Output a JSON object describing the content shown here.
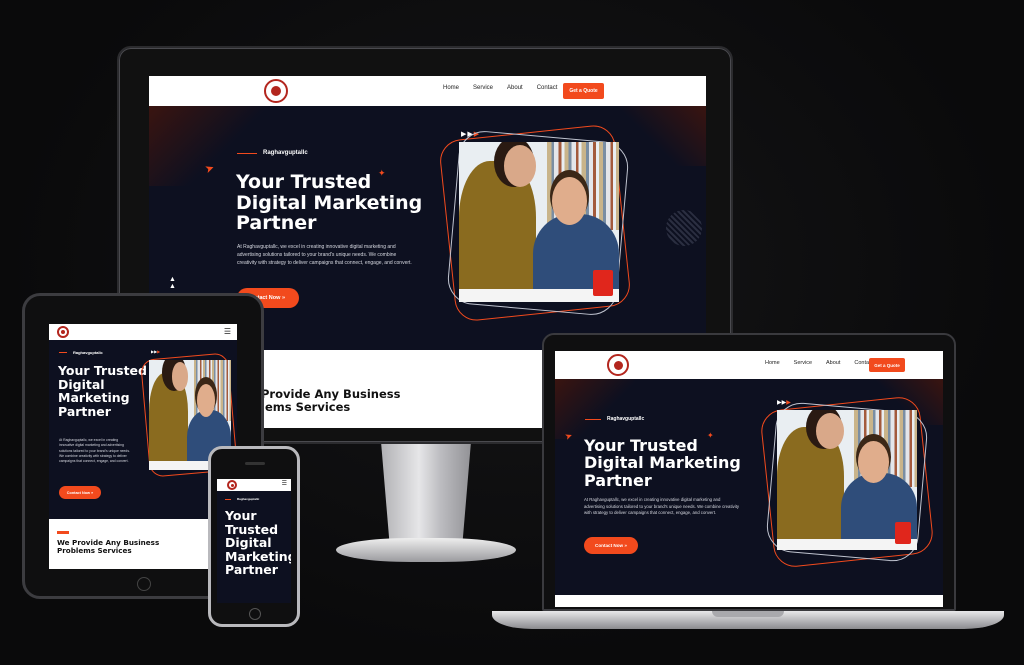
{
  "nav": {
    "items": [
      "Home",
      "Service",
      "About",
      "Contact"
    ],
    "quote_button": "Get a Quote"
  },
  "hero": {
    "eyebrow": "Raghavguptallc",
    "title_line1": "Your Trusted",
    "title_line2": "Digital Marketing",
    "title_line3": "Partner",
    "paragraph": "At Raghavguptallc, we excel in creating innovative digital marketing and advertising solutions tailored to your brand's unique needs. We combine creativity with strategy to deliver campaigns that connect, engage, and convert.",
    "cta": "Contact Now",
    "cta_partial": "ntact Now"
  },
  "section2": {
    "title_line1": "We Provide Any Business",
    "title_line2": "Problems Services",
    "monitor_line1": "Provide Any Business",
    "monitor_line2": "lems Services"
  },
  "icons": {
    "menu": "hamburger-icon",
    "arrow": "double-chevron-right-icon"
  },
  "colors": {
    "accent": "#f24a1d",
    "hero_bg": "#0d1020",
    "page_bg": "#0b0b0c"
  }
}
